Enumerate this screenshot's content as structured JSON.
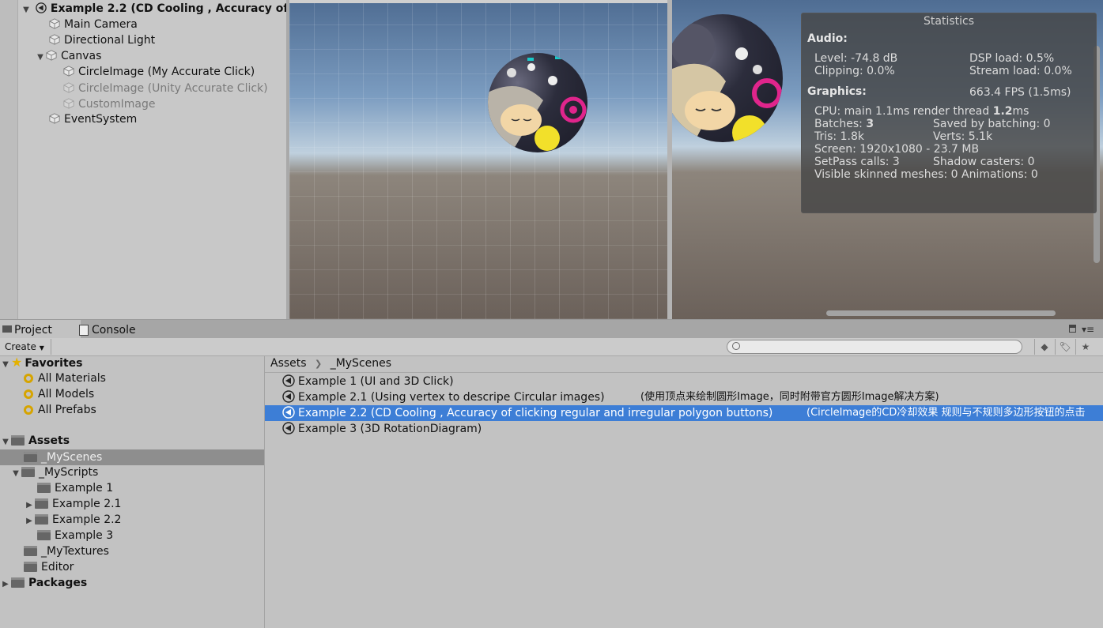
{
  "hierarchy": {
    "scene_title": "Example 2.2 (CD Cooling , Accuracy of",
    "items": [
      {
        "label": "Main Camera"
      },
      {
        "label": "Directional Light"
      },
      {
        "label": "Canvas"
      },
      {
        "label": "CircleImage (My Accurate Click)"
      },
      {
        "label": "CircleImage (Unity Accurate Click)"
      },
      {
        "label": "CustomImage"
      },
      {
        "label": "EventSystem"
      }
    ]
  },
  "stats": {
    "title": "Statistics",
    "audio_header": "Audio:",
    "level": "Level: -74.8 dB",
    "dsp_load": "DSP load: 0.5%",
    "clipping": "Clipping: 0.0%",
    "stream_load": "Stream load: 0.0%",
    "graphics_header": "Graphics:",
    "fps": "663.4 FPS (1.5ms)",
    "cpu_prefix": "CPU: main 1.1ms  render thread ",
    "cpu_render": "1.2",
    "cpu_unit": "ms",
    "batches_label": "Batches: ",
    "batches_value": "3",
    "saved_batching": "Saved by batching: 0",
    "tris": "Tris: 1.8k",
    "verts": "Verts: 5.1k",
    "screen": "Screen: 1920x1080 - 23.7 MB",
    "setpass": "SetPass calls: 3",
    "shadow_casters": "Shadow casters: 0",
    "skinned": "Visible skinned meshes: 0  Animations: 0"
  },
  "tabs": {
    "project": "Project",
    "console": "Console"
  },
  "toolbar": {
    "create_label": "Create"
  },
  "tree": {
    "favorites": "Favorites",
    "all_materials": "All Materials",
    "all_models": "All Models",
    "all_prefabs": "All Prefabs",
    "assets": "Assets",
    "my_scenes": "_MyScenes",
    "my_scripts": "_MyScripts",
    "ex1": "Example 1",
    "ex21": "Example 2.1",
    "ex22": "Example 2.2",
    "ex3": "Example 3",
    "my_textures": "_MyTextures",
    "editor": "Editor",
    "packages": "Packages"
  },
  "breadcrumb": {
    "root": "Assets",
    "current": "_MyScenes"
  },
  "files": [
    {
      "name": "Example 1 (UI and 3D Click)",
      "note": ""
    },
    {
      "name": "Example 2.1 (Using vertex to descripe Circular images)",
      "note": "(使用顶点来绘制圆形Image，同时附带官方圆形Image解决方案)"
    },
    {
      "name": "Example 2.2 (CD Cooling , Accuracy of clicking regular and irregular polygon buttons)",
      "note": "(CircleImage的CD冷却效果  规则与不规则多边形按钮的点击"
    },
    {
      "name": "Example 3 (3D RotationDiagram)",
      "note": ""
    }
  ],
  "colors": {
    "selection": "#3d7ed6",
    "accent_folder": "#666666"
  }
}
